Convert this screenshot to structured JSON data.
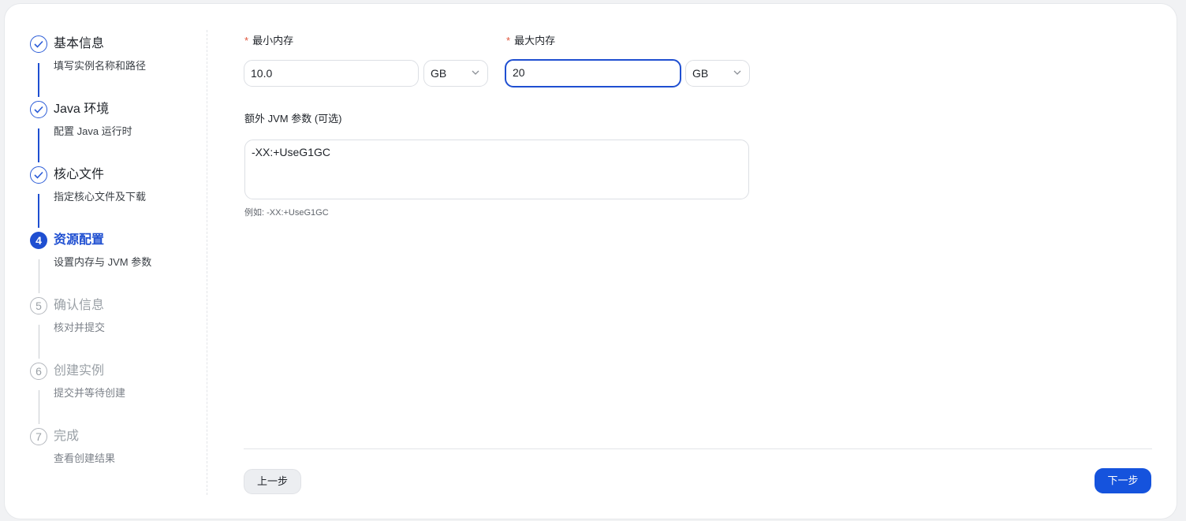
{
  "steps": [
    {
      "title": "基本信息",
      "desc": "填写实例名称和路径",
      "state": "done"
    },
    {
      "title": "Java 环境",
      "desc": "配置 Java 运行时",
      "state": "done"
    },
    {
      "title": "核心文件",
      "desc": "指定核心文件及下载",
      "state": "done"
    },
    {
      "number": "4",
      "title": "资源配置",
      "desc": "设置内存与 JVM 参数",
      "state": "active"
    },
    {
      "number": "5",
      "title": "确认信息",
      "desc": "核对并提交",
      "state": "pending"
    },
    {
      "number": "6",
      "title": "创建实例",
      "desc": "提交并等待创建",
      "state": "pending"
    },
    {
      "number": "7",
      "title": "完成",
      "desc": "查看创建结果",
      "state": "pending"
    }
  ],
  "form": {
    "required_mark": "*",
    "min_memory": {
      "label": "最小内存",
      "value": "10.0",
      "unit": "GB"
    },
    "max_memory": {
      "label": "最大内存",
      "value": "20",
      "unit": "GB"
    },
    "jvm_args": {
      "label": "额外 JVM 参数 (可选)",
      "value": "-XX:+UseG1GC",
      "hint": "例如: -XX:+UseG1GC"
    }
  },
  "footer": {
    "prev_label": "上一步",
    "next_label": "下一步"
  },
  "colors": {
    "accent": "#1f4fd1",
    "required": "#e0553c"
  }
}
